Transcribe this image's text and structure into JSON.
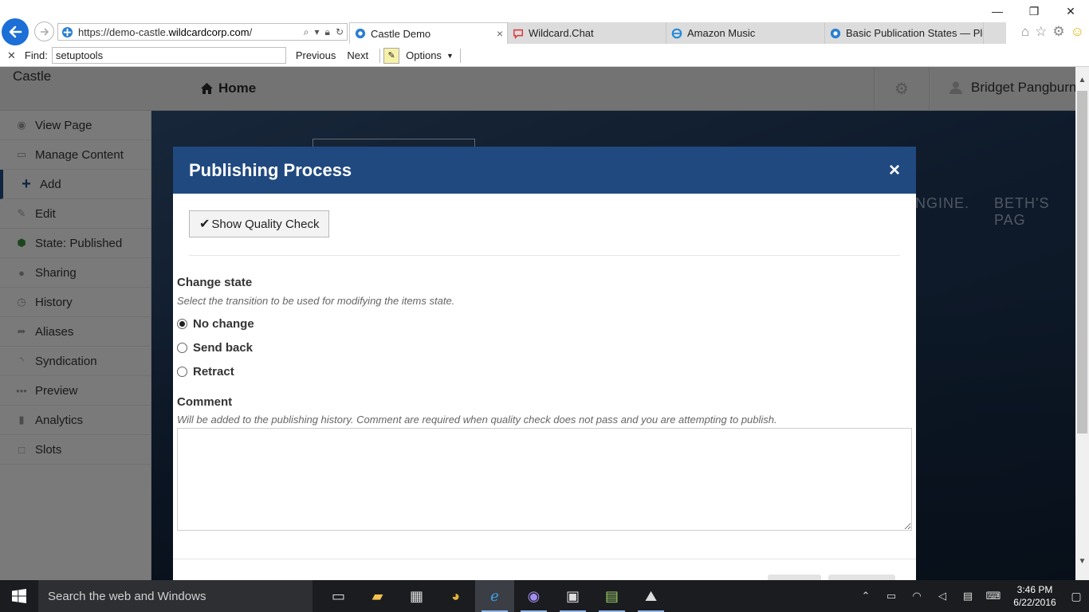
{
  "window": {
    "minimize_label": "—",
    "restore_label": "❐",
    "close_label": "✕"
  },
  "browser": {
    "url_prefix": "https://demo-castle.",
    "url_domain": "wildcardcorp.com",
    "url_suffix": "/",
    "tabs": [
      {
        "title": "Castle Demo",
        "active": true,
        "close_label": "×"
      },
      {
        "title": "Wildcard.Chat",
        "active": false
      },
      {
        "title": "Amazon Music",
        "active": false
      },
      {
        "title": "Basic Publication States — Plo...",
        "active": false
      }
    ]
  },
  "findbar": {
    "close_label": "✕",
    "label": "Find:",
    "query": "setuptools",
    "previous_label": "Previous",
    "next_label": "Next",
    "options_label": "Options"
  },
  "site": {
    "brand": "Castle",
    "home_label": "Home",
    "user_name": "Bridget Pangburn"
  },
  "sidebar": {
    "items": [
      {
        "label": "View Page",
        "icon": "eye-icon"
      },
      {
        "label": "Manage Content",
        "icon": "folder-icon"
      },
      {
        "label": "Add",
        "icon": "plus-icon"
      },
      {
        "label": "Edit",
        "icon": "pencil-icon"
      },
      {
        "label": "State: Published",
        "icon": "shield-icon"
      },
      {
        "label": "Sharing",
        "icon": "user-icon"
      },
      {
        "label": "History",
        "icon": "clock-icon"
      },
      {
        "label": "Aliases",
        "icon": "share-icon"
      },
      {
        "label": "Syndication",
        "icon": "rss-icon"
      },
      {
        "label": "Preview",
        "icon": "ellipsis-icon"
      },
      {
        "label": "Analytics",
        "icon": "bar-chart-icon"
      },
      {
        "label": "Slots",
        "icon": "square-icon"
      }
    ]
  },
  "hero": {
    "nav_items": [
      "NGINE.",
      "BETH'S PAG"
    ]
  },
  "modal": {
    "title": "Publishing Process",
    "close_label": "×",
    "quality_check_label": "Show Quality Check",
    "change_state": {
      "label": "Change state",
      "help": "Select the transition to be used for modifying the items state.",
      "options": [
        {
          "label": "No change",
          "checked": true
        },
        {
          "label": "Send back",
          "checked": false
        },
        {
          "label": "Retract",
          "checked": false
        }
      ]
    },
    "comment": {
      "label": "Comment",
      "help": "Will be added to the publishing history. Comment are required when quality check does not pass and you are attempting to publish.",
      "value": ""
    }
  },
  "taskbar": {
    "search_placeholder": "Search the web and Windows",
    "time": "3:46 PM",
    "date": "6/22/2016"
  },
  "colors": {
    "modal_header": "#20497f",
    "browser_back": "#1b6fd6",
    "taskbar": "#1a1c1f"
  }
}
